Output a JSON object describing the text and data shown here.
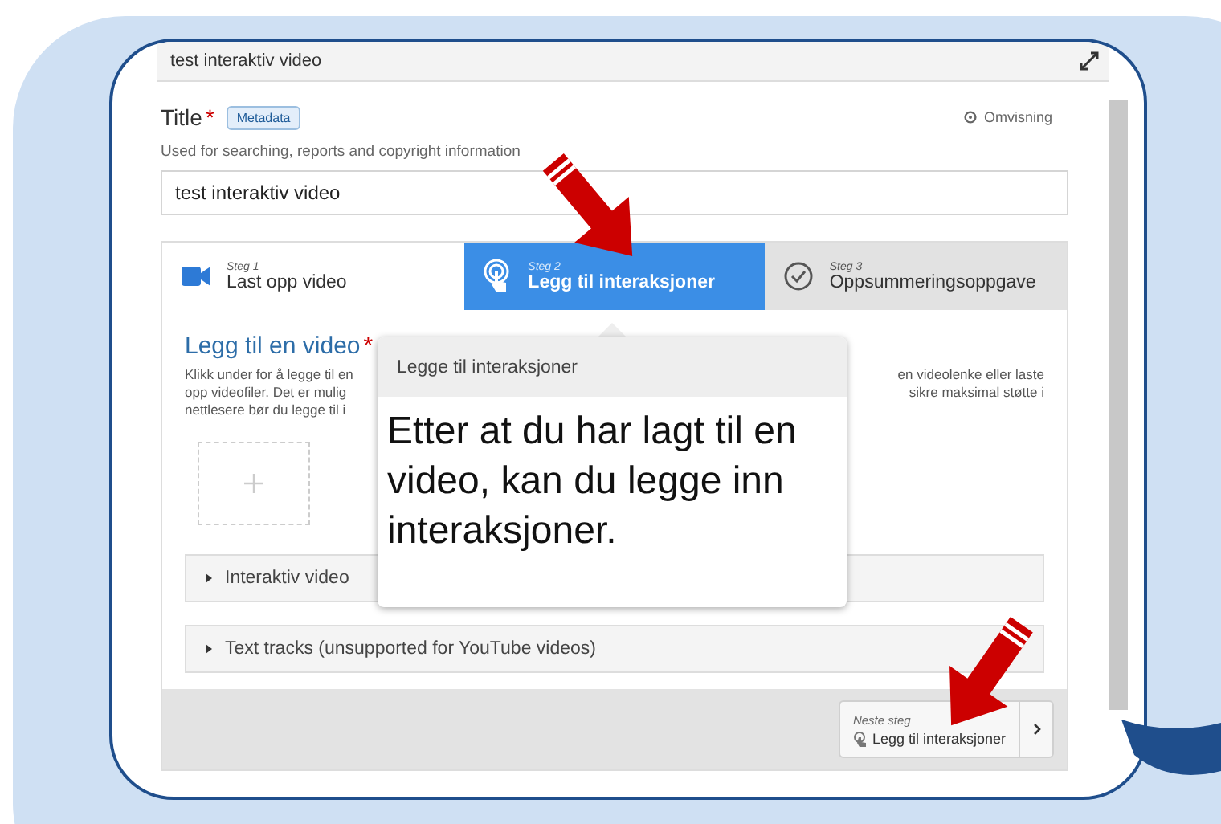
{
  "editor": {
    "title": "test interaktiv video"
  },
  "title_field": {
    "label": "Title",
    "required_mark": "*",
    "tag": "Metadata",
    "tour_link": "Omvisning",
    "description": "Used for searching, reports and copyright information",
    "value": "test interaktiv video"
  },
  "steps": [
    {
      "step": "Steg 1",
      "label": "Last opp video",
      "kind": "video",
      "selected": false
    },
    {
      "step": "Steg 2",
      "label": "Legg til interaksjoner",
      "kind": "touch",
      "selected": true
    },
    {
      "step": "Steg 3",
      "label": "Oppsummeringsoppgave",
      "kind": "check",
      "selected": false
    }
  ],
  "video_section": {
    "heading": "Legg til en video",
    "required_mark": "*",
    "description_left": [
      "Klikk under for å legge til en",
      "opp videofiler. Det er mulig",
      "nettlesere bør du legge til i"
    ],
    "description_right": [
      "en videolenke eller laste",
      "sikre maksimal støtte i"
    ]
  },
  "accordion": [
    {
      "label": "Interaktiv video",
      "expanded": false
    },
    {
      "label": "Text tracks (unsupported for YouTube videos)",
      "expanded": false
    }
  ],
  "tooltip": {
    "title": "Legge til interaksjoner",
    "text": "Etter at du har lagt til en video, kan du legge inn interaksjoner."
  },
  "next_step": {
    "caption": "Neste steg",
    "label": "Legg til interaksjoner"
  }
}
